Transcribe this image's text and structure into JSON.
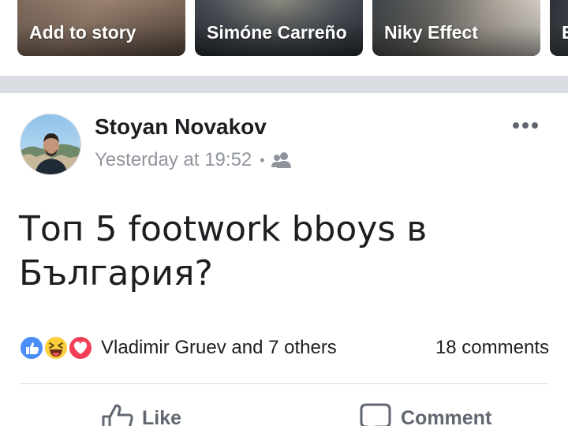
{
  "stories": [
    {
      "label": "Add to story"
    },
    {
      "label": "Simóne Carreño"
    },
    {
      "label": "Niky Effect"
    },
    {
      "label": "E"
    }
  ],
  "post": {
    "author": "Stoyan Novakov",
    "timestamp": "Yesterday at 19:52",
    "separator": "•",
    "audience_icon": "friends-icon",
    "text": "Топ 5 footwork bboys в България?",
    "reactions": {
      "icons": [
        "like-reaction-icon",
        "haha-reaction-icon",
        "love-reaction-icon"
      ],
      "summary": "Vladimir Gruev and 7 others"
    },
    "comments_count": "18 comments",
    "actions": {
      "like_label": "Like",
      "comment_label": "Comment"
    }
  },
  "colors": {
    "accent_blue": "#3b5998",
    "like_blue": "#4a8ff7",
    "love_red": "#f33e58",
    "haha_yellow": "#fcd03d",
    "separator_gray": "#dadde1",
    "meta_gray": "#90949c",
    "text_dark": "#1c1e21"
  }
}
